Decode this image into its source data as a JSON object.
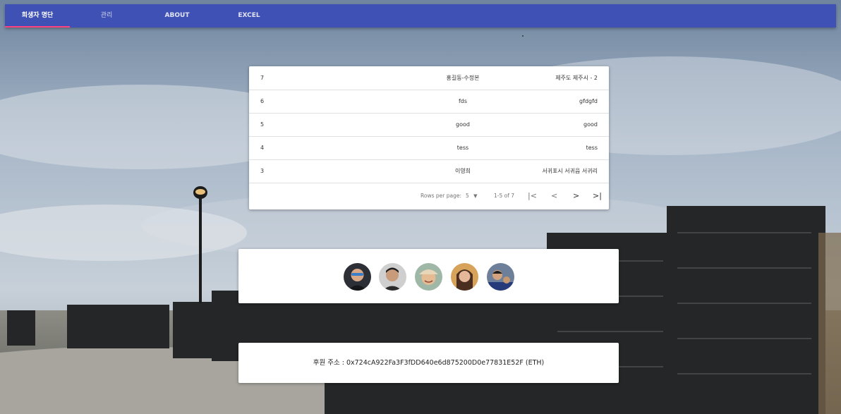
{
  "nav": {
    "tabs": [
      {
        "label": "희생자 명단"
      },
      {
        "label": "관리"
      },
      {
        "label": "ABOUT"
      },
      {
        "label": "EXCEL"
      }
    ]
  },
  "table": {
    "rows": [
      {
        "id": "7",
        "name": "홍길동-수정본",
        "address": "제주도 제주시 - 2"
      },
      {
        "id": "6",
        "name": "fds",
        "address": "gfdgfd"
      },
      {
        "id": "5",
        "name": "good",
        "address": "good"
      },
      {
        "id": "4",
        "name": "tess",
        "address": "tess"
      },
      {
        "id": "3",
        "name": "이영희",
        "address": "서귀포시 서귀읍 서귀리"
      }
    ],
    "pagination": {
      "rows_per_page_label": "Rows per page:",
      "rows_per_page_value": "5",
      "range": "1-5 of 7",
      "first_icon": "first-page-icon",
      "prev_icon": "chevron-left-icon",
      "next_icon": "chevron-right-icon",
      "last_icon": "last-page-icon"
    }
  },
  "avatars": [
    "avatar-1",
    "avatar-2",
    "avatar-3",
    "avatar-4",
    "avatar-5"
  ],
  "donate": {
    "text": "후원 주소 : 0x724cA922Fa3F3fDD640e6d875200D0e77831E52F (ETH)"
  },
  "colors": {
    "primary": "#3f51b5",
    "accent": "#ff4081"
  }
}
